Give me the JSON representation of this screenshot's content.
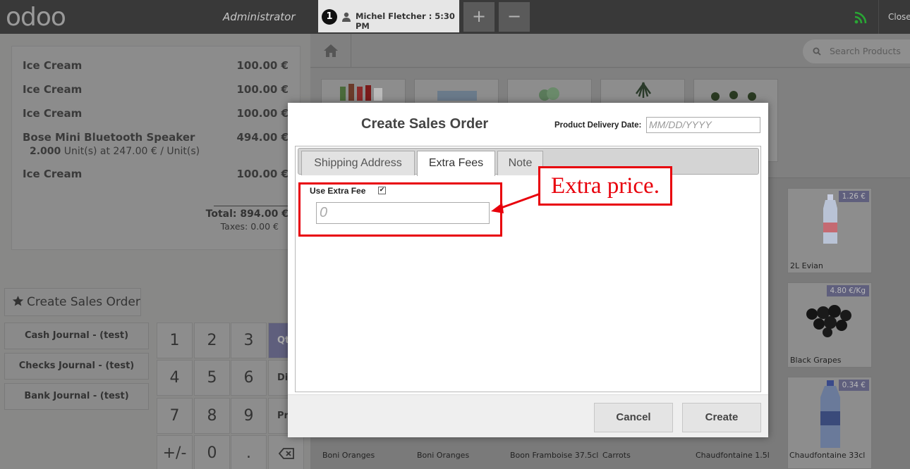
{
  "topbar": {
    "logo": "odoo",
    "user": "Administrator",
    "order": {
      "number": "1",
      "label": "Michel Fletcher : 5:30 PM"
    },
    "add_button": "+",
    "remove_button": "−",
    "close_label": "Close",
    "rss_color": "#29a634"
  },
  "order": {
    "lines": [
      {
        "name": "Ice Cream",
        "price": "100.00 €"
      },
      {
        "name": "Ice Cream",
        "price": "100.00 €"
      },
      {
        "name": "Ice Cream",
        "price": "100.00 €"
      },
      {
        "name": "Bose Mini Bluetooth Speaker",
        "price": "494.00 €",
        "detail_qty": "2.000",
        "detail_rest": " Unit(s) at 247.00 € / Unit(s)"
      },
      {
        "name": "Ice Cream",
        "price": "100.00 €"
      }
    ],
    "total": "Total: 894.00 €",
    "taxes": "Taxes: 0.00 €"
  },
  "left_actions": {
    "create_sales_order": "Create Sales Order",
    "journals": [
      "Cash Journal - (test)",
      "Checks Journal - (test)",
      "Bank Journal - (test)"
    ]
  },
  "numpad": {
    "keys": [
      "1",
      "2",
      "3",
      "4",
      "5",
      "6",
      "7",
      "8",
      "9",
      "+/-",
      "0",
      "."
    ],
    "modes": [
      "Qt",
      "Dis",
      "Pri"
    ]
  },
  "products_panel": {
    "search_placeholder": "Search Products",
    "products": [
      {
        "price": "1.26 €",
        "name": "2L Evian"
      },
      {
        "price": "4.80 €/Kg",
        "name": "Black Grapes"
      },
      {
        "price": "0.34 €",
        "name": ""
      }
    ],
    "bottom_names": [
      "Boni Oranges",
      "Boni Oranges",
      "Boon Framboise 37.5cl",
      "Carrots",
      "Chaudfontaine 1.5l",
      "Chaudfontaine 33cl"
    ]
  },
  "modal": {
    "title": "Create Sales Order",
    "delivery_date_label": "Product Delivery Date:",
    "delivery_date_placeholder": "MM/DD/YYYY",
    "tabs": [
      "Shipping Address",
      "Extra Fees",
      "Note"
    ],
    "active_tab": "Extra Fees",
    "use_extra_fee_label": "Use Extra Fee",
    "use_extra_fee_checked": true,
    "extra_fee_placeholder": "0",
    "cancel": "Cancel",
    "create": "Create"
  },
  "annotation": {
    "callout_text": "Extra price.",
    "color": "#e8000b"
  }
}
